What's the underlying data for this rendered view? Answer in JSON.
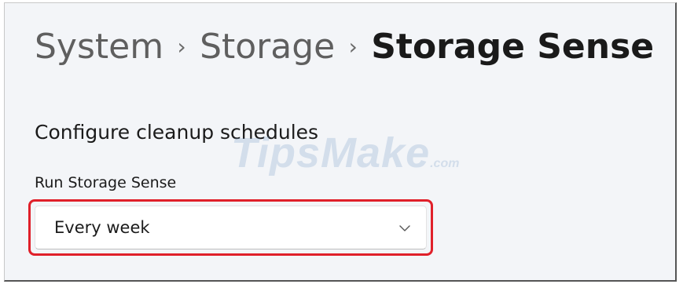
{
  "breadcrumb": {
    "items": [
      "System",
      "Storage",
      "Storage Sense"
    ],
    "separator": "›"
  },
  "section": {
    "title": "Configure cleanup schedules"
  },
  "run_storage_sense": {
    "label": "Run Storage Sense",
    "selected": "Every week",
    "icon": "chevron-down-icon"
  },
  "highlight": {
    "color": "#e0202a"
  },
  "watermark": {
    "text": "TipsMake",
    "suffix": ".com"
  }
}
